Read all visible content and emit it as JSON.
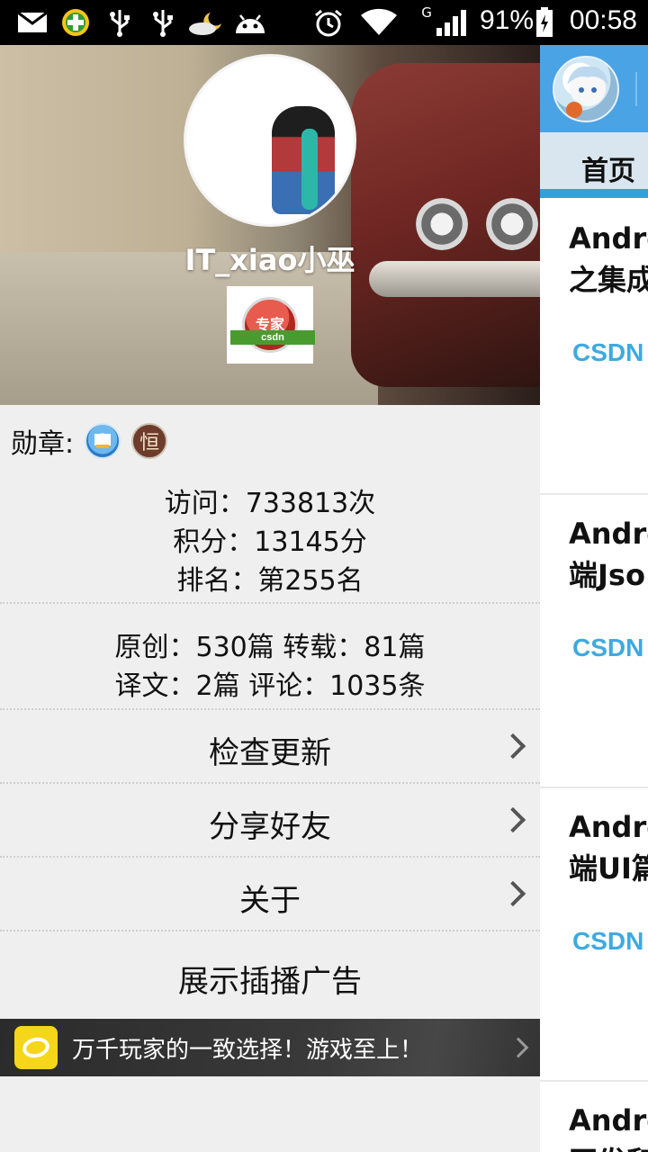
{
  "status_bar": {
    "battery_percent": "91%",
    "time": "00:58",
    "network_type": "G",
    "icons": [
      "mail-icon",
      "app-badge-icon",
      "usb-icon",
      "usb-icon",
      "weather-icon",
      "android-icon",
      "alarm-icon",
      "wifi-icon",
      "signal-icon",
      "battery-icon"
    ]
  },
  "drawer": {
    "username": "IT_xiao小巫",
    "expert_badge": {
      "text": "专家",
      "ribbon": "csdn"
    },
    "medals_label": "勋章:",
    "medal_2_glyph": "恒",
    "stats": {
      "visits": "访问：733813次",
      "points": "积分：13145分",
      "rank": "排名：第255名",
      "original_reposts": "原创：530篇 转载：81篇",
      "translations_comments": "译文：2篇 评论：1035条"
    },
    "menu": [
      {
        "label": "检查更新",
        "has_chevron": true
      },
      {
        "label": "分享好友",
        "has_chevron": true
      },
      {
        "label": "关于",
        "has_chevron": true
      },
      {
        "label": "展示插播广告",
        "has_chevron": false
      }
    ],
    "ad": {
      "text": "万千玩家的一致选择！游戏至上！"
    }
  },
  "main_page": {
    "tab_home": "首页",
    "articles": [
      {
        "line1": "Andro",
        "line2": "之集成",
        "source": "CSDN"
      },
      {
        "line1": "Andro",
        "line2": "端Jso",
        "source": "CSDN"
      },
      {
        "line1": "Andro",
        "line2": "端UI篇",
        "source": "CSDN"
      },
      {
        "line1": "Andro",
        "line2": "开发和",
        "source": ""
      }
    ]
  },
  "colors": {
    "topbar_blue": "#4aa3e5",
    "tab_indicator": "#2fa2dd",
    "csdn_blue": "#3fa9df",
    "drawer_bg": "#efefef"
  }
}
